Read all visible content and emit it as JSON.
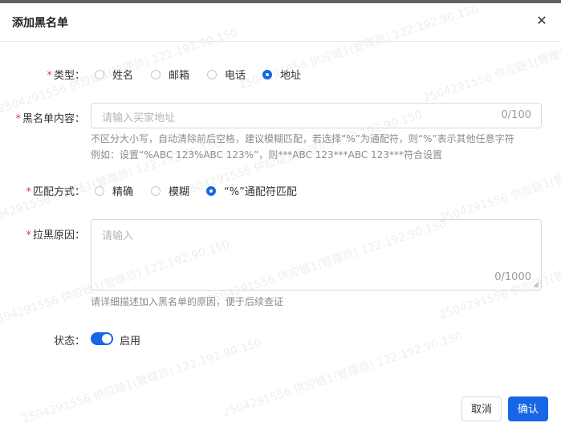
{
  "dialog": {
    "title": "添加黑名单",
    "close_icon": "close-icon"
  },
  "form": {
    "type": {
      "label": "类型：",
      "required": "*",
      "options": [
        "姓名",
        "邮箱",
        "电话",
        "地址"
      ],
      "selected": "地址"
    },
    "content": {
      "label": "黑名单内容：",
      "required": "*",
      "placeholder": "请输入买家地址",
      "counter": "0/100",
      "hint_line1": "不区分大小写，自动清除前后空格，建议模糊匹配，若选择“%”为通配符，则“%”表示其他任意字符",
      "hint_line2": "例如：设置“%ABC 123%ABC 123%”，则***ABC 123***ABC 123***符合设置"
    },
    "match": {
      "label": "匹配方式：",
      "required": "*",
      "options": [
        "精确",
        "模糊",
        "“%”通配符匹配"
      ],
      "selected": "“%”通配符匹配"
    },
    "reason": {
      "label": "拉黑原因：",
      "required": "*",
      "placeholder": "请输入",
      "counter": "0/1000",
      "hint": "请详细描述加入黑名单的原因，便于后续查证"
    },
    "status": {
      "label": "状态：",
      "toggle_label": "启用",
      "enabled": true
    }
  },
  "footer": {
    "cancel_label": "取消",
    "confirm_label": "确认"
  },
  "watermark": "2504291556 供应链1(管理员) 122.192.90.150",
  "colors": {
    "accent": "#1666e6",
    "required": "#e33333",
    "top_strip": "#5f6266"
  }
}
